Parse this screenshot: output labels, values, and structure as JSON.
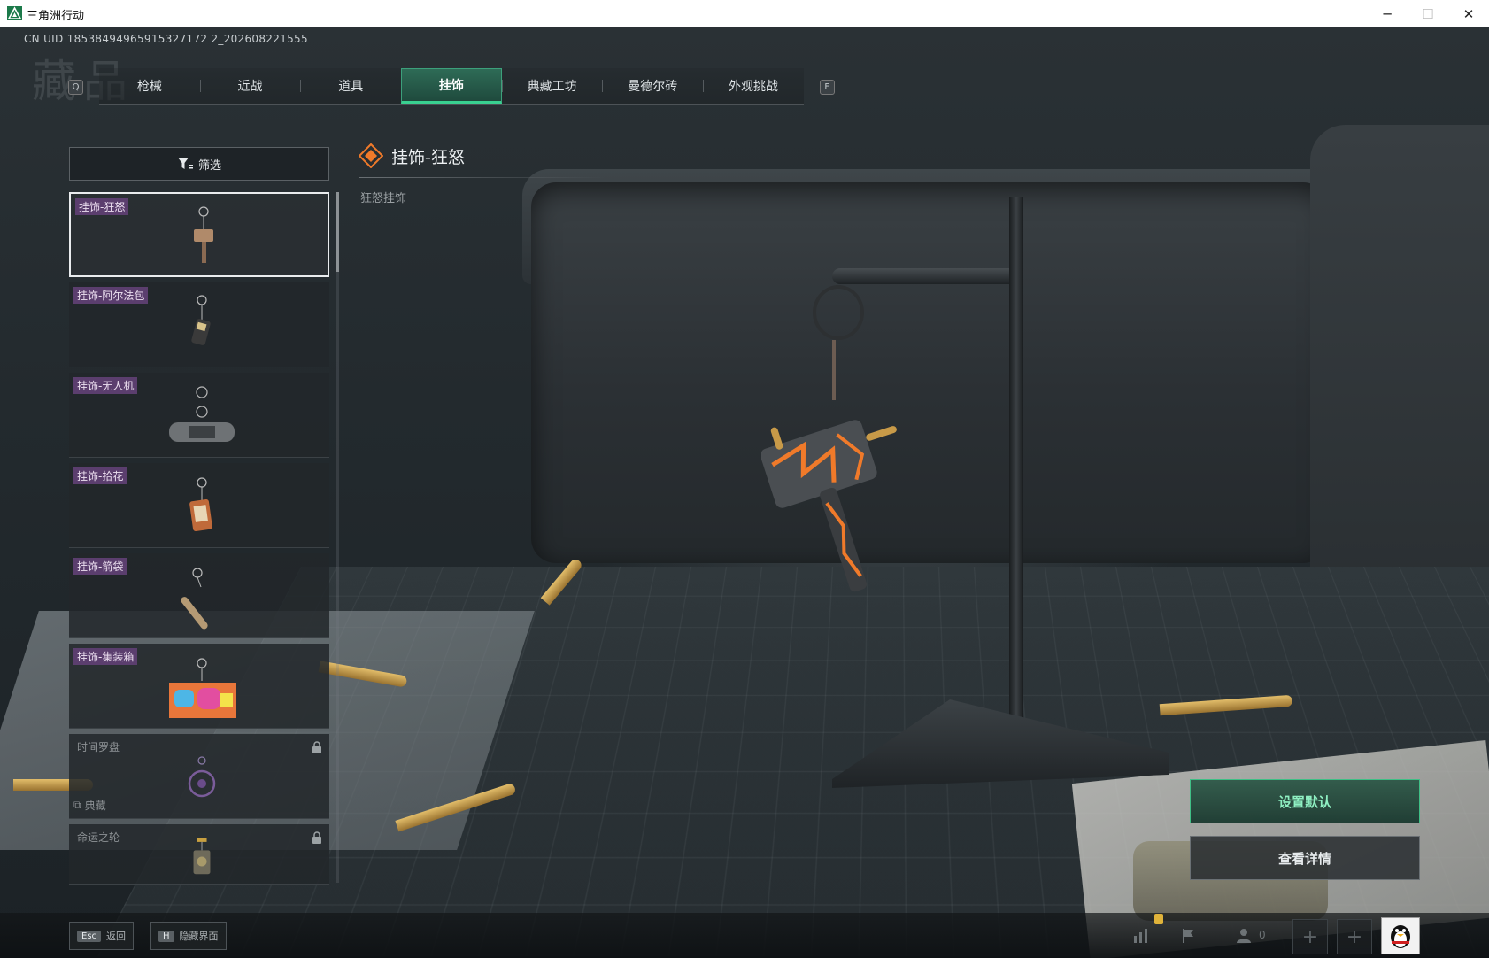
{
  "window": {
    "title": "三角洲行动",
    "min_glyph": "─",
    "max_glyph": "☐",
    "close_glyph": "✕"
  },
  "header": {
    "uid": "CN UID 18538494965915327172 2_202608221555",
    "page_title": "藏品",
    "key_left": "Q",
    "key_right": "E"
  },
  "tabs": [
    {
      "label": "枪械",
      "active": false
    },
    {
      "label": "近战",
      "active": false
    },
    {
      "label": "道具",
      "active": false
    },
    {
      "label": "挂饰",
      "active": true
    },
    {
      "label": "典藏工坊",
      "active": false
    },
    {
      "label": "曼德尔砖",
      "active": false
    },
    {
      "label": "外观挑战",
      "active": false
    }
  ],
  "filter": {
    "label": "筛选",
    "icon": "filter-icon"
  },
  "items": [
    {
      "label": "挂饰-狂怒",
      "selected": true,
      "locked": false,
      "sub": ""
    },
    {
      "label": "挂饰-阿尔法包",
      "selected": false,
      "locked": false,
      "sub": ""
    },
    {
      "label": "挂饰-无人机",
      "selected": false,
      "locked": false,
      "sub": ""
    },
    {
      "label": "挂饰-拾花",
      "selected": false,
      "locked": false,
      "sub": ""
    },
    {
      "label": "挂饰-箭袋",
      "selected": false,
      "locked": false,
      "sub": ""
    },
    {
      "label": "挂饰-集装箱",
      "selected": false,
      "locked": false,
      "sub": ""
    },
    {
      "label": "时间罗盘",
      "selected": false,
      "locked": true,
      "sub": "典藏"
    },
    {
      "label": "命运之轮",
      "selected": false,
      "locked": true,
      "sub": ""
    }
  ],
  "detail": {
    "title": "挂饰-狂怒",
    "subtitle": "狂怒挂饰",
    "icon": "diamond-rank-icon"
  },
  "actions": {
    "set_default": "设置默认",
    "view_details": "查看详情"
  },
  "bottom": {
    "back_key": "Esc",
    "back_label": "返回",
    "hide_key": "H",
    "hide_label": "隐藏界面",
    "friends_count": "0",
    "plus_glyph": "+"
  },
  "colors": {
    "accent_green": "#39d191",
    "label_purple": "#5b3e6e",
    "orange": "#f07a2a"
  }
}
